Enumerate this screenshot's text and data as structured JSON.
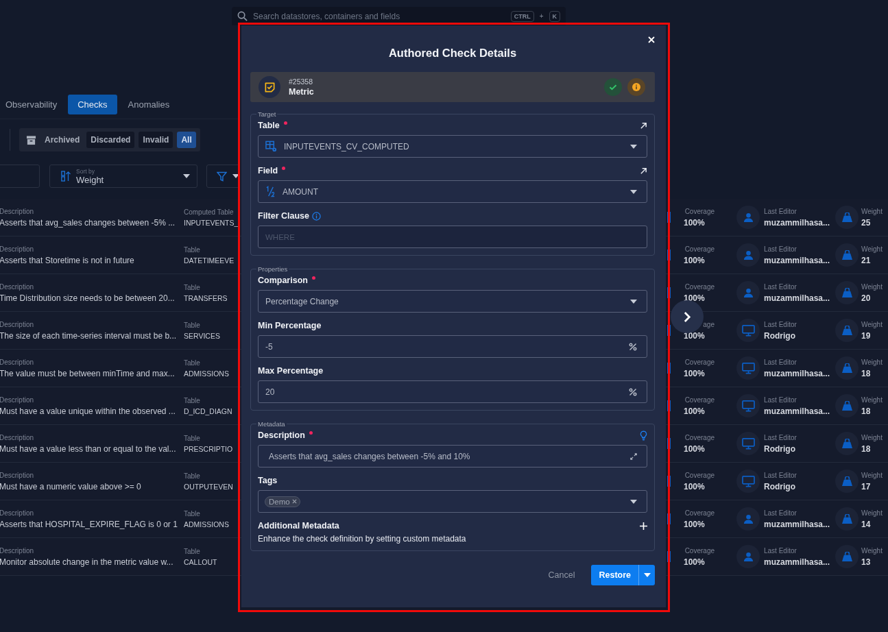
{
  "search": {
    "placeholder": "Search datastores, containers and fields",
    "shortcut": [
      "CTRL",
      "+",
      "K"
    ]
  },
  "tabs": [
    {
      "label": "Observability",
      "selected": false
    },
    {
      "label": "Checks",
      "selected": true
    },
    {
      "label": "Anomalies",
      "selected": false
    }
  ],
  "status_filter": [
    {
      "label": "Archived",
      "kind": "label",
      "selected": false
    },
    {
      "label": "Discarded",
      "kind": "option",
      "selected": false
    },
    {
      "label": "Invalid",
      "kind": "option",
      "selected": false
    },
    {
      "label": "All",
      "kind": "option",
      "selected": true
    }
  ],
  "sort": {
    "label": "Sort by",
    "value": "Weight"
  },
  "checks": [
    {
      "kind": "user",
      "description_label": "Description",
      "description": "Asserts that avg_sales changes between -5% ...",
      "table_label": "Computed Table",
      "table": "INPUTEVENTS_",
      "coverage_label": "Coverage",
      "coverage": "100%",
      "editor_label": "Last Editor",
      "editor": "muzammilhasa...",
      "weight_label": "Weight",
      "weight": "25"
    },
    {
      "kind": "user",
      "description_label": "Description",
      "description": "Asserts that Storetime is not in future",
      "table_label": "Table",
      "table": "DATETIMEEVE",
      "coverage_label": "Coverage",
      "coverage": "100%",
      "editor_label": "Last Editor",
      "editor": "muzammilhasa...",
      "weight_label": "Weight",
      "weight": "21"
    },
    {
      "kind": "user",
      "description_label": "Description",
      "description": "Time Distribution size needs to be between 20...",
      "table_label": "Table",
      "table": "TRANSFERS",
      "coverage_label": "Coverage",
      "coverage": "100%",
      "editor_label": "Last Editor",
      "editor": "muzammilhasa...",
      "weight_label": "Weight",
      "weight": "20"
    },
    {
      "kind": "computer",
      "description_label": "Description",
      "description": "The size of each time-series interval must be b...",
      "table_label": "Table",
      "table": "SERVICES",
      "coverage_label": "age",
      "coverage": "100%",
      "editor_label": "Last Editor",
      "editor": "Rodrigo",
      "weight_label": "Weight",
      "weight": "19"
    },
    {
      "kind": "computer",
      "description_label": "Description",
      "description": "The value must be between minTime and max...",
      "table_label": "Table",
      "table": "ADMISSIONS",
      "coverage_label": "Coverage",
      "coverage": "100%",
      "editor_label": "Last Editor",
      "editor": "muzammilhasa...",
      "weight_label": "Weight",
      "weight": "18"
    },
    {
      "kind": "computer",
      "description_label": "Description",
      "description": "Must have a value unique within the observed ...",
      "table_label": "Table",
      "table": "D_ICD_DIAGN",
      "coverage_label": "Coverage",
      "coverage": "100%",
      "editor_label": "Last Editor",
      "editor": "muzammilhasa...",
      "weight_label": "Weight",
      "weight": "18"
    },
    {
      "kind": "computer",
      "description_label": "Description",
      "description": "Must have a value less than or equal to the val...",
      "table_label": "Table",
      "table": "PRESCRIPTIO",
      "coverage_label": "Coverage",
      "coverage": "100%",
      "editor_label": "Last Editor",
      "editor": "Rodrigo",
      "weight_label": "Weight",
      "weight": "18"
    },
    {
      "kind": "computer",
      "description_label": "Description",
      "description": "Must have a numeric value above >= 0",
      "table_label": "Table",
      "table": "OUTPUTEVEN",
      "coverage_label": "Coverage",
      "coverage": "100%",
      "editor_label": "Last Editor",
      "editor": "Rodrigo",
      "weight_label": "Weight",
      "weight": "17"
    },
    {
      "kind": "user",
      "description_label": "Description",
      "description": "Asserts that HOSPITAL_EXPIRE_FLAG is 0 or 1",
      "table_label": "Table",
      "table": "ADMISSIONS",
      "coverage_label": "Coverage",
      "coverage": "100%",
      "editor_label": "Last Editor",
      "editor": "muzammilhasa...",
      "weight_label": "Weight",
      "weight": "14"
    },
    {
      "kind": "user",
      "description_label": "Description",
      "description": "Monitor absolute change in the metric value w...",
      "table_label": "Table",
      "table": "CALLOUT",
      "coverage_label": "Coverage",
      "coverage": "100%",
      "editor_label": "Last Editor",
      "editor": "muzammilhasa...",
      "weight_label": "Weight",
      "weight": "13"
    }
  ],
  "modal": {
    "title": "Authored Check Details",
    "check": {
      "id": "#25358",
      "type": "Metric"
    },
    "sections": [
      {
        "legend": "Target",
        "fields": [
          {
            "kind": "table-select",
            "label": "Table",
            "required": true,
            "value": "INPUTEVENTS_CV_COMPUTED"
          },
          {
            "kind": "field-select",
            "label": "Field",
            "required": true,
            "value": "AMOUNT"
          },
          {
            "kind": "filter",
            "label": "Filter Clause",
            "required": false,
            "placeholder": "WHERE"
          }
        ]
      },
      {
        "legend": "Properties",
        "fields": [
          {
            "kind": "select",
            "label": "Comparison",
            "required": true,
            "value": "Percentage Change"
          },
          {
            "kind": "percent",
            "label": "Min Percentage",
            "required": false,
            "value": "-5"
          },
          {
            "kind": "percent",
            "label": "Max Percentage",
            "required": false,
            "value": "20"
          }
        ]
      },
      {
        "legend": "Metadata",
        "fields": [
          {
            "kind": "description",
            "label": "Description",
            "required": true,
            "value": "Asserts that avg_sales changes between -5% and 10%"
          },
          {
            "kind": "tags",
            "label": "Tags",
            "required": false,
            "tags": [
              "Demo"
            ]
          }
        ],
        "extra": {
          "title": "Additional Metadata",
          "hint": "Enhance the check definition by setting custom metadata"
        }
      }
    ],
    "cancel": "Cancel",
    "primary": "Restore"
  }
}
